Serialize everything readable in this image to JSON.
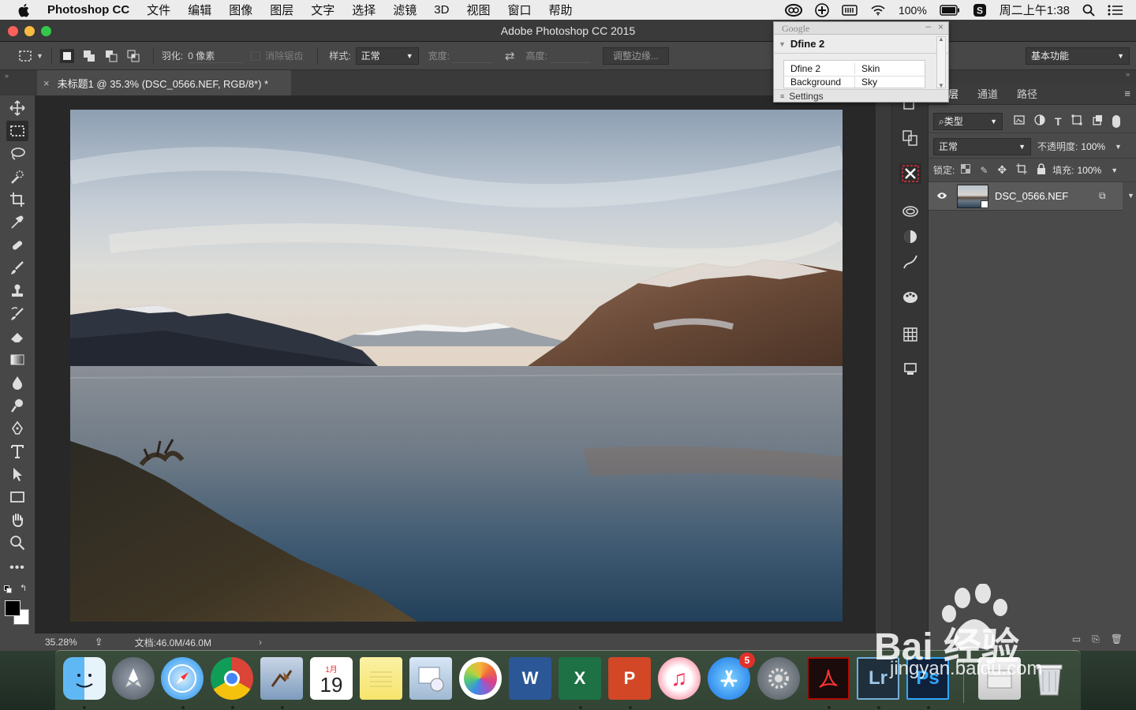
{
  "menubar": {
    "app_name": "Photoshop CC",
    "items": [
      "文件",
      "编辑",
      "图像",
      "图层",
      "文字",
      "选择",
      "滤镜",
      "3D",
      "视图",
      "窗口",
      "帮助"
    ],
    "battery": "100%",
    "clock": "周二上午1:38"
  },
  "window": {
    "title": "Adobe Photoshop CC 2015"
  },
  "options_bar": {
    "feather_label": "羽化:",
    "feather_value": "0 像素",
    "antialias_label": "消除锯齿",
    "style_label": "样式:",
    "style_value": "正常",
    "width_label": "宽度:",
    "height_label": "高度:",
    "refine_edge_button": "调整边缘...",
    "workspace_value": "基本功能"
  },
  "document": {
    "tab_title": "未标题1 @ 35.3% (DSC_0566.NEF, RGB/8*) *",
    "zoom": "35.28%",
    "doc_size": "文档:46.0M/46.0M"
  },
  "google_popup": {
    "brand": "Google",
    "header": "Dfine 2",
    "rows": [
      [
        "Dfine 2",
        "Skin"
      ],
      [
        "Background",
        "Sky"
      ]
    ],
    "settings": "Settings"
  },
  "layers_panel": {
    "tabs": [
      "图层",
      "通道",
      "路径"
    ],
    "filter_kind": "类型",
    "blend_mode": "正常",
    "opacity_label": "不透明度:",
    "opacity_value": "100%",
    "lock_label": "锁定:",
    "fill_label": "填充:",
    "fill_value": "100%",
    "layers": [
      {
        "name": "DSC_0566.NEF",
        "visible": true
      }
    ]
  },
  "dock": {
    "apps": [
      "Finder",
      "Launchpad",
      "Safari",
      "Chrome",
      "Mail",
      "Calendar",
      "Notes",
      "Preview",
      "Photos",
      "Word",
      "Excel",
      "PowerPoint",
      "iTunes",
      "App Store",
      "System Preferences",
      "Acrobat",
      "Lightroom",
      "Photoshop",
      "Documents",
      "Trash"
    ],
    "calendar_month": "1月",
    "calendar_day": "19",
    "appstore_badge": "5"
  },
  "watermark": {
    "brand": "Bai 经验",
    "url": "jingyan.baidu.com"
  },
  "colors": {
    "ui_dark": "#282828",
    "panel": "#474747",
    "accent_red": "#d9343a"
  }
}
